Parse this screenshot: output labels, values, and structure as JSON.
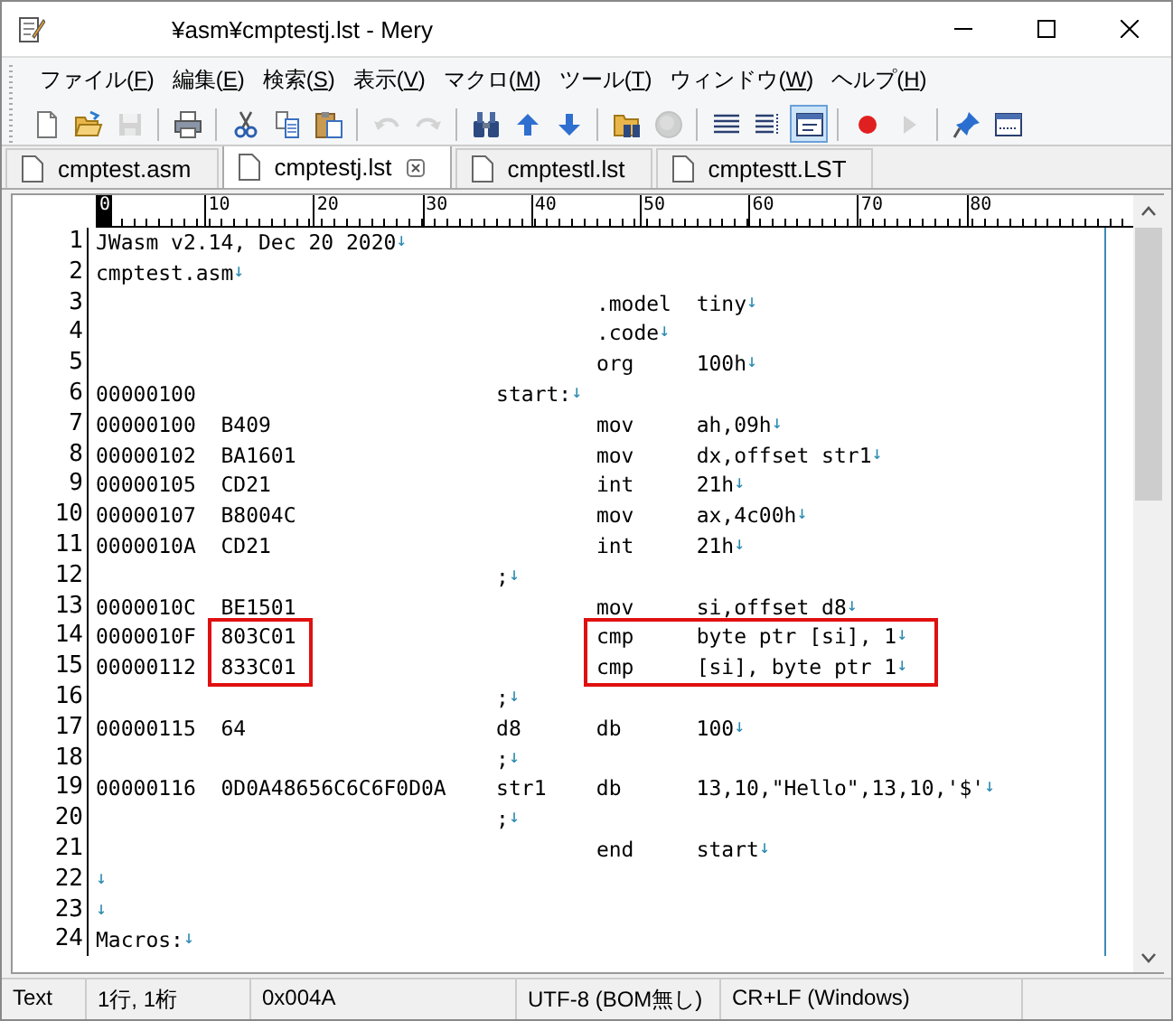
{
  "window": {
    "title": "¥asm¥cmptestj.lst - Mery"
  },
  "menu": [
    "ファイル(F)",
    "編集(E)",
    "検索(S)",
    "表示(V)",
    "マクロ(M)",
    "ツール(T)",
    "ウィンドウ(W)",
    "ヘルプ(H)"
  ],
  "toolbar": [
    {
      "kind": "new",
      "disabled": false,
      "selected": false
    },
    {
      "kind": "open",
      "disabled": false,
      "selected": false
    },
    {
      "kind": "save",
      "disabled": true,
      "selected": false
    },
    {
      "kind": "separator"
    },
    {
      "kind": "print",
      "disabled": false,
      "selected": false
    },
    {
      "kind": "separator"
    },
    {
      "kind": "cut",
      "disabled": false,
      "selected": false
    },
    {
      "kind": "copy",
      "disabled": false,
      "selected": false
    },
    {
      "kind": "paste",
      "disabled": false,
      "selected": false
    },
    {
      "kind": "separator"
    },
    {
      "kind": "undo",
      "disabled": true,
      "selected": false
    },
    {
      "kind": "redo",
      "disabled": true,
      "selected": false
    },
    {
      "kind": "separator"
    },
    {
      "kind": "find",
      "disabled": false,
      "selected": false
    },
    {
      "kind": "find-up",
      "disabled": false,
      "selected": false
    },
    {
      "kind": "find-down",
      "disabled": false,
      "selected": false
    },
    {
      "kind": "separator"
    },
    {
      "kind": "find-in-files",
      "disabled": false,
      "selected": false
    },
    {
      "kind": "stop",
      "disabled": true,
      "selected": false
    },
    {
      "kind": "separator"
    },
    {
      "kind": "lines",
      "disabled": false,
      "selected": false
    },
    {
      "kind": "wrap",
      "disabled": false,
      "selected": false
    },
    {
      "kind": "window",
      "disabled": false,
      "selected": true
    },
    {
      "kind": "separator"
    },
    {
      "kind": "record",
      "disabled": false,
      "selected": false
    },
    {
      "kind": "play",
      "disabled": true,
      "selected": false
    },
    {
      "kind": "separator"
    },
    {
      "kind": "pin",
      "disabled": false,
      "selected": false
    },
    {
      "kind": "panel",
      "disabled": false,
      "selected": false
    }
  ],
  "tabs": [
    {
      "label": "cmptest.asm",
      "selected": false
    },
    {
      "label": "cmptestj.lst",
      "selected": true
    },
    {
      "label": "cmptestl.lst",
      "selected": false
    },
    {
      "label": "cmptestt.LST",
      "selected": false
    }
  ],
  "ruler": {
    "labels": [
      {
        "text": "0",
        "current": true
      },
      {
        "text": "10",
        "current": false
      },
      {
        "text": "20",
        "current": false
      },
      {
        "text": "30",
        "current": false
      },
      {
        "text": "40",
        "current": false
      },
      {
        "text": "50",
        "current": false
      },
      {
        "text": "60",
        "current": false
      },
      {
        "text": "70",
        "current": false
      },
      {
        "text": "80",
        "current": false
      }
    ]
  },
  "lines": [
    {
      "number": "1",
      "kind": "plain",
      "text": "JWasm v2.14, Dec 20 2020",
      "eol": "↓",
      "highlighted": false
    },
    {
      "number": "2",
      "kind": "plain",
      "text": "cmptest.asm",
      "eol": "↓",
      "highlighted": false
    },
    {
      "number": "3",
      "kind": "listing",
      "mnemonic": ".model",
      "operands": "tiny",
      "eol": "↓",
      "highlighted": false
    },
    {
      "number": "4",
      "kind": "listing",
      "mnemonic": ".code",
      "eol": "↓",
      "highlighted": false
    },
    {
      "number": "5",
      "kind": "listing",
      "mnemonic": "org",
      "operands": "100h",
      "eol": "↓",
      "highlighted": false
    },
    {
      "number": "6",
      "kind": "listing",
      "address": "00000100",
      "label": "start:",
      "eol": "↓",
      "highlighted": false
    },
    {
      "number": "7",
      "kind": "listing",
      "address": "00000100",
      "bytes": "B409",
      "mnemonic": "mov",
      "operands": "ah,09h",
      "eol": "↓",
      "highlighted": false
    },
    {
      "number": "8",
      "kind": "listing",
      "address": "00000102",
      "bytes": "BA1601",
      "mnemonic": "mov",
      "operands": "dx,offset str1",
      "eol": "↓",
      "highlighted": false
    },
    {
      "number": "9",
      "kind": "listing",
      "address": "00000105",
      "bytes": "CD21",
      "mnemonic": "int",
      "operands": "21h",
      "eol": "↓",
      "highlighted": false
    },
    {
      "number": "10",
      "kind": "listing",
      "address": "00000107",
      "bytes": "B8004C",
      "mnemonic": "mov",
      "operands": "ax,4c00h",
      "eol": "↓",
      "highlighted": false
    },
    {
      "number": "11",
      "kind": "listing",
      "address": "0000010A",
      "bytes": "CD21",
      "mnemonic": "int",
      "operands": "21h",
      "eol": "↓",
      "highlighted": false
    },
    {
      "number": "12",
      "kind": "listing",
      "label": ";",
      "eol": "↓",
      "highlighted": false
    },
    {
      "number": "13",
      "kind": "listing",
      "address": "0000010C",
      "bytes": "BE1501",
      "mnemonic": "mov",
      "operands": "si,offset d8",
      "eol": "↓",
      "highlighted": false
    },
    {
      "number": "14",
      "kind": "listing",
      "address": "0000010F",
      "bytes": "803C01",
      "mnemonic": "cmp",
      "operands": "byte ptr [si], 1",
      "eol": "↓",
      "highlighted": true
    },
    {
      "number": "15",
      "kind": "listing",
      "address": "00000112",
      "bytes": "833C01",
      "mnemonic": "cmp",
      "operands": "[si], byte ptr 1",
      "eol": "↓",
      "highlighted": true
    },
    {
      "number": "16",
      "kind": "listing",
      "label": ";",
      "eol": "↓",
      "highlighted": false
    },
    {
      "number": "17",
      "kind": "listing",
      "address": "00000115",
      "bytes": "64",
      "label": "d8",
      "mnemonic": "db",
      "operands": "100",
      "eol": "↓",
      "highlighted": false
    },
    {
      "number": "18",
      "kind": "listing",
      "label": ";",
      "eol": "↓",
      "highlighted": false
    },
    {
      "number": "19",
      "kind": "listing",
      "address": "00000116",
      "bytes": "0D0A48656C6C6F0D0A",
      "label": "str1",
      "mnemonic": "db",
      "operands": "13,10,\"Hello\",13,10,'$'",
      "eol": "↓",
      "highlighted": false
    },
    {
      "number": "20",
      "kind": "listing",
      "label": ";",
      "eol": "↓",
      "highlighted": false
    },
    {
      "number": "21",
      "kind": "listing",
      "mnemonic": "end",
      "operands": "start",
      "eol": "↓",
      "highlighted": false
    },
    {
      "number": "22",
      "kind": "plain",
      "eol": "↓",
      "highlighted": false
    },
    {
      "number": "23",
      "kind": "plain",
      "eol": "↓",
      "highlighted": false
    },
    {
      "number": "24",
      "kind": "plain",
      "text": "Macros:",
      "eol": "↓",
      "highlighted": false
    }
  ],
  "status_bar": [
    "Text",
    "1行, 1桁",
    "0x004A",
    "UTF-8 (BOM無し)",
    "CR+LF (Windows)"
  ]
}
